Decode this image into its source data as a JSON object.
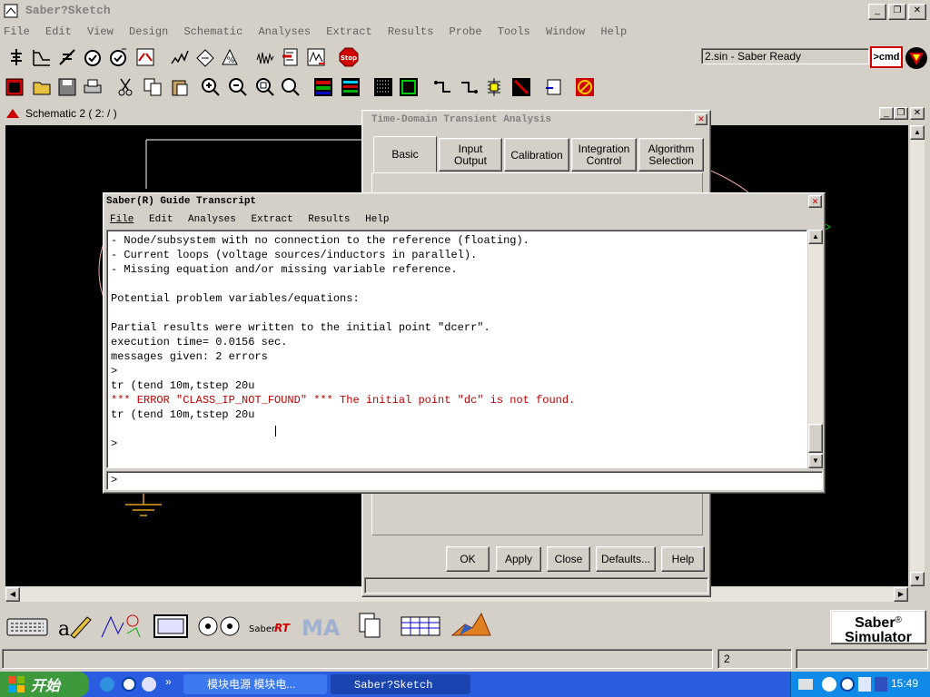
{
  "app": {
    "title": "Saber?Sketch",
    "menu": [
      "File",
      "Edit",
      "View",
      "Design",
      "Schematic",
      "Analyses",
      "Extract",
      "Results",
      "Probe",
      "Tools",
      "Window",
      "Help"
    ],
    "status_field": "2.sin - Saber Ready",
    "cmd_label": ">cmd",
    "bottom_status_page": "2",
    "brand_line1": "Saber",
    "brand_reg": "®",
    "brand_line2": "Simulator"
  },
  "toolbar1": [
    "parts-gallery-icon",
    "dc-analysis-icon",
    "operating-point-icon",
    "stopwatch-icon",
    "transient-icon",
    "sweep-icon",
    "fourier-icon",
    "stress-icon",
    "vary-icon",
    "noise-icon",
    "monte-carlo-icon",
    "sensitivity-icon",
    "stop-icon"
  ],
  "toolbar1_stop_label": "Stop",
  "schematic": {
    "title": "Schematic 2 ( 2: / )"
  },
  "transient_dialog": {
    "title": "Time-Domain Transient Analysis",
    "tabs": [
      {
        "label": "Basic"
      },
      {
        "label": "Input\nOutput"
      },
      {
        "label": "Calibration"
      },
      {
        "label": "Integration\nControl"
      },
      {
        "label": "Algorithm\nSelection"
      }
    ],
    "buttons": {
      "ok": "OK",
      "apply": "Apply",
      "close": "Close",
      "defaults": "Defaults...",
      "help": "Help"
    }
  },
  "transcript": {
    "title": "Saber(R) Guide Transcript",
    "menu": [
      "File",
      "Edit",
      "Analyses",
      "Extract",
      "Results",
      "Help"
    ],
    "lines": [
      {
        "text": "- Node/subsystem with no connection to the reference (floating).",
        "error": false
      },
      {
        "text": "- Current loops (voltage sources/inductors in parallel).",
        "error": false
      },
      {
        "text": "- Missing equation and/or missing variable reference.",
        "error": false
      },
      {
        "text": "",
        "error": false
      },
      {
        "text": "Potential problem variables/equations:",
        "error": false
      },
      {
        "text": "",
        "error": false
      },
      {
        "text": "Partial results were written to the initial point \"dcerr\".",
        "error": false
      },
      {
        "text": "execution time= 0.0156 sec.",
        "error": false
      },
      {
        "text": "messages given: 2 errors",
        "error": false
      },
      {
        "text": ">",
        "error": false
      },
      {
        "text": "tr (tend 10m,tstep 20u",
        "error": false
      },
      {
        "text": "*** ERROR \"CLASS_IP_NOT_FOUND\" *** The initial point \"dc\" is not found.",
        "error": true
      },
      {
        "text": "tr (tend 10m,tstep 20u",
        "error": false
      },
      {
        "text": "",
        "error": false
      },
      {
        "text": ">",
        "error": false
      }
    ],
    "prompt": ">"
  },
  "taskbar": {
    "start_label": "开始",
    "tasks": [
      {
        "label": "模块电源 模块电..."
      },
      {
        "label": "Saber?Sketch"
      }
    ],
    "clock": "15:49"
  }
}
